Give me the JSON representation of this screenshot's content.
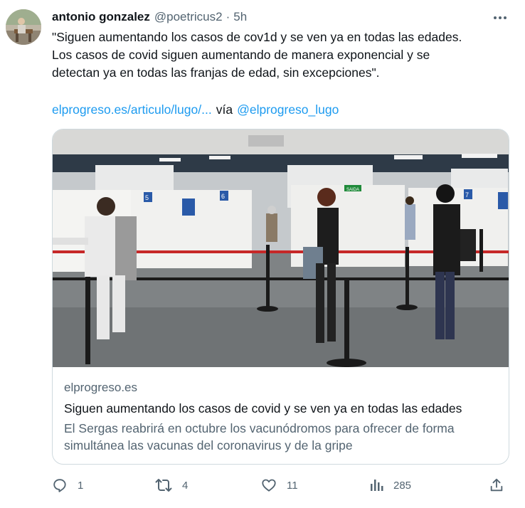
{
  "tweet": {
    "author": {
      "name": "antonio gonzalez",
      "handle": "@poetricus2",
      "separator": "·",
      "time": "5h",
      "avatar_icon": "avatar-photo"
    },
    "text_line1": "\"Siguen aumentando los casos de cov1d y se ven ya en todas las edades.",
    "text_line2": "Los casos de covid siguen aumentando de manera exponencial y se",
    "text_line3": "detectan ya en todas las franjas de edad, sin excepciones\".",
    "link_url": "elprogreso.es/articulo/lugo/...",
    "via_label": "vía",
    "via_handle": "@elprogreso_lugo",
    "more_icon": "more-horizontal-icon"
  },
  "card": {
    "image_icon": "vaccination-center-photo",
    "domain": "elprogreso.es",
    "title": "Siguen aumentando los casos de covid y se ven ya en todas las edades",
    "description": "El Sergas reabrirá en octubre los vacunódromos para ofrecer de forma simultánea las vacunas del coronavirus y de la gripe",
    "booth_5": "5",
    "booth_6": "6",
    "booth_7": "7",
    "exit_sign": "SAIDA"
  },
  "actions": {
    "reply_count": "1",
    "retweet_count": "4",
    "like_count": "11",
    "views_count": "285",
    "icons": [
      "reply-icon",
      "retweet-icon",
      "like-icon",
      "views-icon",
      "share-icon"
    ]
  },
  "colors": {
    "link": "#1d9bf0",
    "secondary_text": "#536471",
    "border": "#cfd9de",
    "primary_text": "#0f1419"
  }
}
